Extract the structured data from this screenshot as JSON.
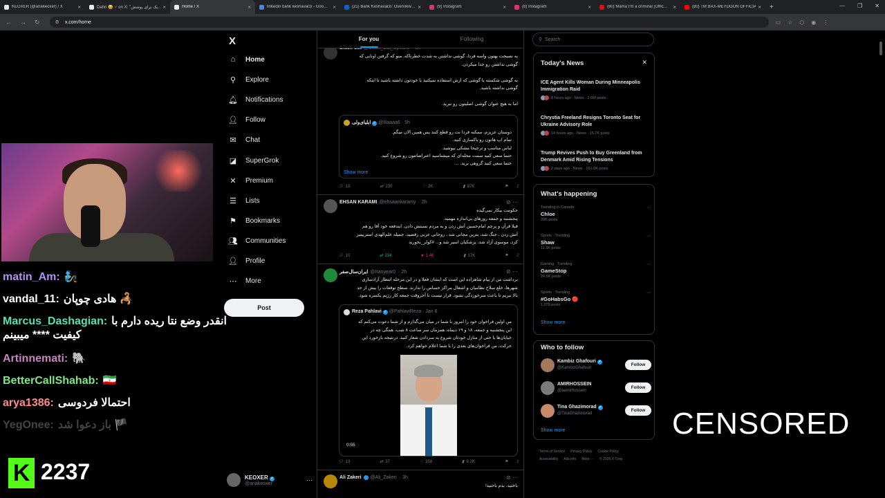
{
  "browser": {
    "tabs": [
      {
        "title": "KEOXER (@ariakeoxer) / X",
        "icon": "x-icon",
        "color": "#e8eaed"
      },
      {
        "title": "Dahri 😄 ♂ on X: \"یک برای پوشش…",
        "icon": "x-icon",
        "color": "#e8eaed"
      },
      {
        "title": "Home / X",
        "icon": "x-icon",
        "color": "#e8eaed",
        "active": true
      },
      {
        "title": "linkedin bank keshavarzi - Goo…",
        "icon": "google-icon",
        "color": "#4285f4"
      },
      {
        "title": "(21) Bank Keshavarzi: Overview…",
        "icon": "linkedin-icon",
        "color": "#0a66c2"
      },
      {
        "title": "(9) Instagram",
        "icon": "instagram-icon",
        "color": "#e1306c"
      },
      {
        "title": "(8) Instagram",
        "icon": "instagram-icon",
        "color": "#e1306c"
      },
      {
        "title": "(80) Mama I'm a criminal (Offic…",
        "icon": "youtube-icon",
        "color": "#ff0000"
      },
      {
        "title": "(80) TM BAX-MEYDOON OFFICIA…",
        "icon": "youtube-icon",
        "color": "#ff0000"
      }
    ],
    "url": "x.com/home"
  },
  "stream": {
    "chat": [
      {
        "user": "matin_Am:",
        "msg": "🧞",
        "color": "#b392f0"
      },
      {
        "user": "vandal_11:",
        "msg": "هادی چوپان 🦂",
        "color": "#ffffff"
      },
      {
        "user": "Marcus_Dashagian:",
        "msg": "انقدر وضع نتا ریده دارم با",
        "msg2": "کیفیت **** میبینم",
        "color": "#59e0b5"
      },
      {
        "user": "Artinnemati:",
        "msg": "🐘",
        "color": "#c586c0"
      },
      {
        "user": "BetterCallShahab:",
        "msg": "🇮🇷",
        "color": "#7ee787"
      },
      {
        "user": "arya1386:",
        "msg": "احتمالا فردوسی",
        "color": "#ff8c8c"
      },
      {
        "user": "YegOnee:",
        "msg": "باز دعوا شد 🏴",
        "color": "#444444"
      }
    ],
    "kick_logo": "K",
    "viewers": "2237",
    "censored": "CENSORED"
  },
  "sidebar": {
    "logo": "X",
    "items": [
      {
        "label": "Home",
        "icon": "home-icon",
        "glyph": "⌂",
        "active": true
      },
      {
        "label": "Explore",
        "icon": "search-icon",
        "glyph": "⚲"
      },
      {
        "label": "Notifications",
        "icon": "bell-icon",
        "glyph": "🔔︎"
      },
      {
        "label": "Follow",
        "icon": "add-user-icon",
        "glyph": "👤︎"
      },
      {
        "label": "Chat",
        "icon": "mail-icon",
        "glyph": "✉"
      },
      {
        "label": "SuperGrok",
        "icon": "grok-icon",
        "glyph": "◪"
      },
      {
        "label": "Premium",
        "icon": "x-premium-icon",
        "glyph": "✕"
      },
      {
        "label": "Lists",
        "icon": "list-icon",
        "glyph": "☰"
      },
      {
        "label": "Bookmarks",
        "icon": "bookmark-icon",
        "glyph": "⚑"
      },
      {
        "label": "Communities",
        "icon": "communities-icon",
        "glyph": "👥︎"
      },
      {
        "label": "Profile",
        "icon": "profile-icon",
        "glyph": "👤︎"
      },
      {
        "label": "More",
        "icon": "more-icon",
        "glyph": "⋯"
      }
    ],
    "post_label": "Post",
    "account": {
      "name": "KEOXER",
      "handle": "@ariakeoxer"
    }
  },
  "feed": {
    "tabs": [
      "For you",
      "Following"
    ],
    "tweets": [
      {
        "author": "Black Cat",
        "handle": "@Black_Cat_Speaks",
        "time": "5h",
        "lines": [
          "یه نصیحت بهتون واسه فردا، گوشی نداشتن به شدت خطرناکه. منو که گرفتن اونایی که",
          "گوشی نداشتن رو جدا میکردن.",
          "",
          "یه گوشی شکسته یا گوشی که ازش استفاده نمیکنید یا خودتون داشته باشید تا اینکه",
          "گوشی نداشته باشید.",
          "",
          "اما به هیچ عنوان گوشی اصلیتون رو نبرید."
        ],
        "quote": {
          "author": "ایلیای‌ولی",
          "handle": "@Iliaaaa6",
          "time": "5h",
          "lines": [
            "دوستان عزیزم، ممکنه فردا نت رو قطع کنند پس همین الان میگم.",
            "تمام اپ هاتون رو پاکسازی کنید.",
            "لباس مناسب و ترجیحا مشکی بپوشید.",
            "حتما سعی کنید سمت محله‌ای که میشناسید اعتراضاتتون رو شروع کنید.",
            "حتما سعی کنید گروهی برید. ..."
          ],
          "show_more": "Show more"
        },
        "stats": {
          "replies": "13",
          "reposts": "230",
          "likes": "2K",
          "views": "87K"
        }
      },
      {
        "author": "EHSAN KARAMI",
        "handle": "@ehsaankaramy",
        "time": "2h",
        "lines": [
          "حکومت بیکار نمی‌گیده",
          "پنجشنبه و جمعه روزهای بی‌اندازه مهمیه.",
          "قبلا قرآن و پرچم امام‌حسین آتش زدن و به مردم نسبتش دادن. ایندفعه خود آقا رو هم",
          "آتش زدن ، جنگ شد، بنزین مجانی شد ، روحانی عربی رقصید، جمیله علم‌الهدی استریپتیز",
          "کرد، موسوی آزاد شد، پزشکیان اسیر شد و... #کولر_بخورید"
        ],
        "stats": {
          "replies": "10",
          "reposts": "234",
          "likes": "1.4K",
          "views": "17K"
        }
      },
      {
        "author": "ایران‌سال‌صفر",
        "handle": "@Iranyear0",
        "time": "2h",
        "lines": [
          "برداشت من از پیام شاهزاده این است که ایشان فعلا و در این مرحله انتظار آزادسازی",
          "شهرها، خلع سلاح نظامیان و اشغال مراکز حساس را ندارند. سطح توقعات را بیش از حد",
          "بالا نبریم تا باعث سرخوردگی نشود. قرار نیست تا آخروقت جمعه کار رژیم یکسره شود."
        ],
        "quote": {
          "author": "Reza Pahlavi",
          "handle": "@PahlaviReza",
          "time": "Jan 6",
          "lines": [
            "من اولین فراخوان خود را امروز با شما در میان می‌گذارم و از شما دعوت می‌کنم که",
            "این پنجشنبه و جمعه، ۱۸ و ۱۹ دیماه، همزمان سر ساعت ۸ شب، همگی چه در",
            "خیابان‌ها یا حتی از منازل خودتان شروع به سردادن شعار کنید. درنتیجه بازخورد این",
            "حرکت، من فراخوان‌های بعدی را با شما اعلام خواهم کرد."
          ],
          "video_time": "0:55"
        },
        "stats": {
          "replies": "13",
          "reposts": "37",
          "likes": "358",
          "views": "9.2K"
        }
      },
      {
        "author": "Ali Zakeri",
        "handle": "@Ali_Zakeri",
        "time": "3h",
        "lines": [
          "باختید، بدم باختید!"
        ]
      }
    ]
  },
  "right": {
    "search_placeholder": "Search",
    "news_title": "Today's News",
    "news": [
      {
        "title": "ICE Agent Kills Woman During Minneapolis Immigration Raid",
        "meta": "8 hours ago · News · 2.6M posts"
      },
      {
        "title": "Chrystia Freeland Resigns Toronto Seat for Ukraine Advisory Role",
        "meta": "14 hours ago · News · 15.7K posts"
      },
      {
        "title": "Trump Revives Push to Buy Greenland from Denmark Amid Rising Tensions",
        "meta": "2 days ago · News · 161.0K posts"
      }
    ],
    "happening_title": "What's happening",
    "trends": [
      {
        "context": "Trending in Canada",
        "name": "Chloe",
        "posts": "20K posts"
      },
      {
        "context": "Sports · Trending",
        "name": "Shaw",
        "posts": "11.3K posts"
      },
      {
        "context": "Gaming · Trending",
        "name": "GameStop",
        "posts": "24.6K posts"
      },
      {
        "context": "Sports · Trending",
        "name": "#GoHabsGo 🔴",
        "posts": "1,078 posts"
      }
    ],
    "show_more": "Show more",
    "wtf_title": "Who to follow",
    "follow": [
      {
        "name": "Kambiz Ghafouri",
        "handle": "@KambizGhafouri",
        "button": "Follow"
      },
      {
        "name": "AMIRHOSSEIN",
        "handle": "@aamirhossein",
        "button": "Follow"
      },
      {
        "name": "Tina Ghazimorad",
        "handle": "@TinaGhazimorad",
        "button": "Follow"
      }
    ],
    "footer": [
      "Terms of Service",
      "Privacy Policy",
      "Cookie Policy",
      "Accessibility",
      "Ads info",
      "More ···",
      "© 2026 X Corp."
    ]
  }
}
